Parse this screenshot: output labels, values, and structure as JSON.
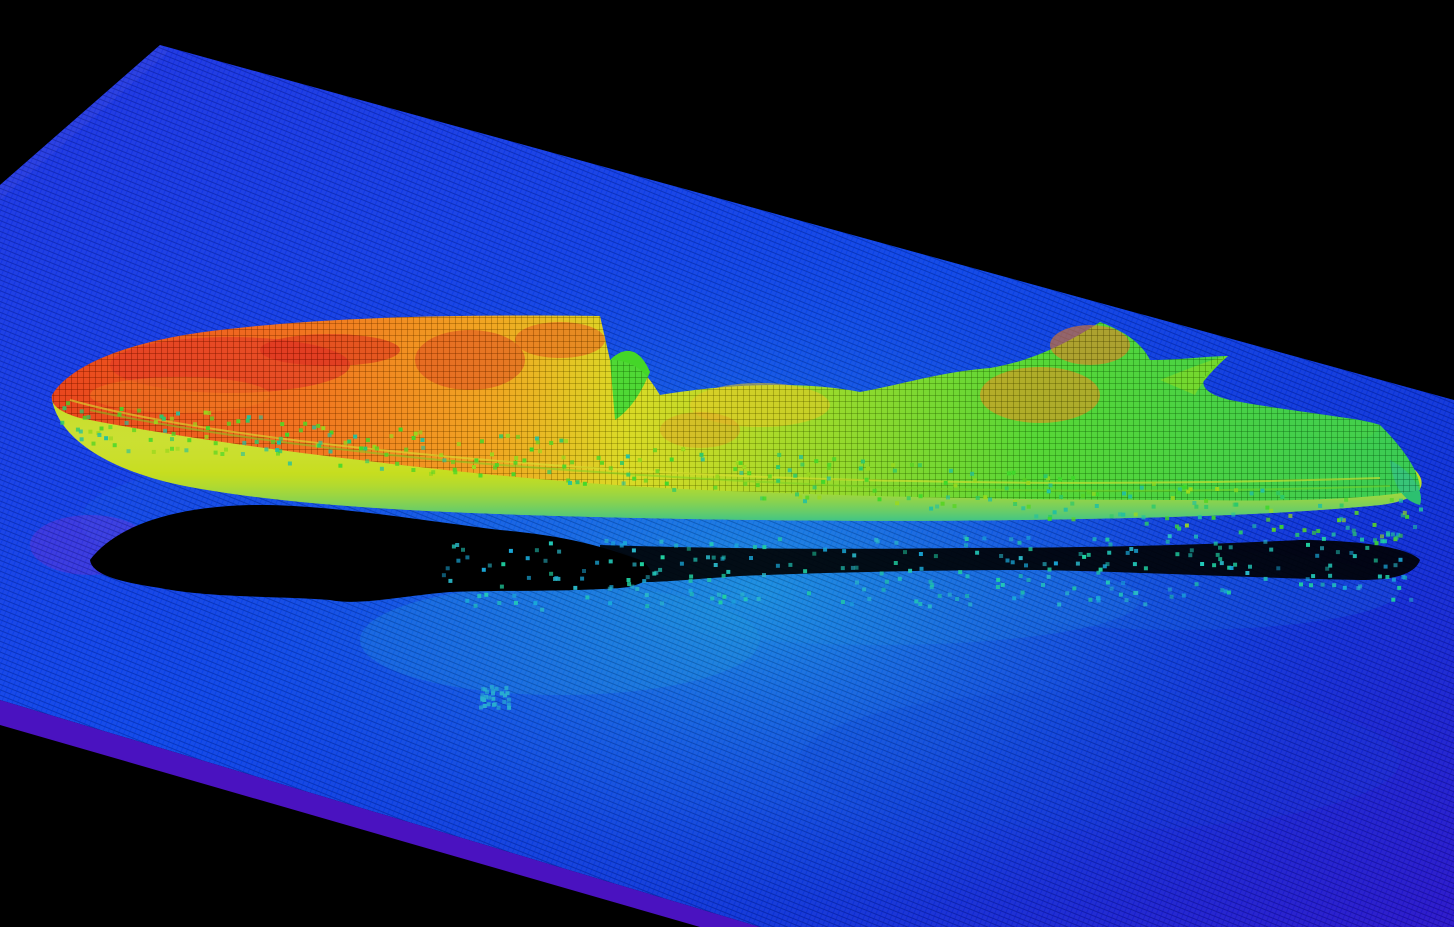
{
  "scene": {
    "subject": "shipwreck-bathymetry",
    "palette": {
      "background": "#000000",
      "seabed_deep": "#1a0fd8",
      "seabed_mid": "#0a3fe6",
      "seabed_light": "#0f7fe0",
      "seabed_edge": "#5010c8",
      "hull_low": "#20c8a8",
      "hull_green": "#3ed82a",
      "hull_yellow": "#d8e018",
      "hull_orange": "#f08a10",
      "hull_peak": "#e42a10",
      "shadow": "#000000"
    }
  }
}
